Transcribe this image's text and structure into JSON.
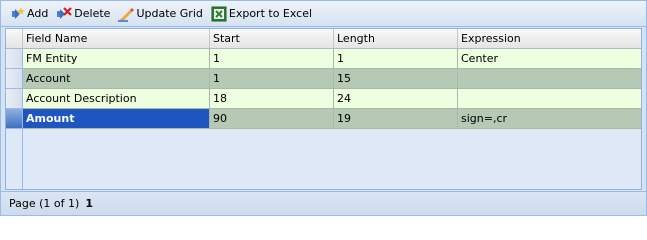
{
  "toolbar": {
    "add_label": "Add",
    "delete_label": "Delete",
    "update_label": "Update Grid",
    "export_label": "Export to Excel"
  },
  "grid": {
    "columns": [
      "Field Name",
      "Start",
      "Length",
      "Expression"
    ],
    "rows": [
      [
        "FM Entity",
        "1",
        "1",
        "Center"
      ],
      [
        "Account",
        "1",
        "15",
        ""
      ],
      [
        "Account Description",
        "18",
        "24",
        ""
      ],
      [
        "Amount",
        "90",
        "19",
        "sign=,cr"
      ]
    ],
    "selected_row_index": 3
  },
  "footer": {
    "page_text": "Page (1 of 1)",
    "page_link": "1"
  },
  "colors": {
    "row_light": "#eeffdf",
    "row_dark": "#b5c9b4",
    "selected": "#1f55c0"
  }
}
